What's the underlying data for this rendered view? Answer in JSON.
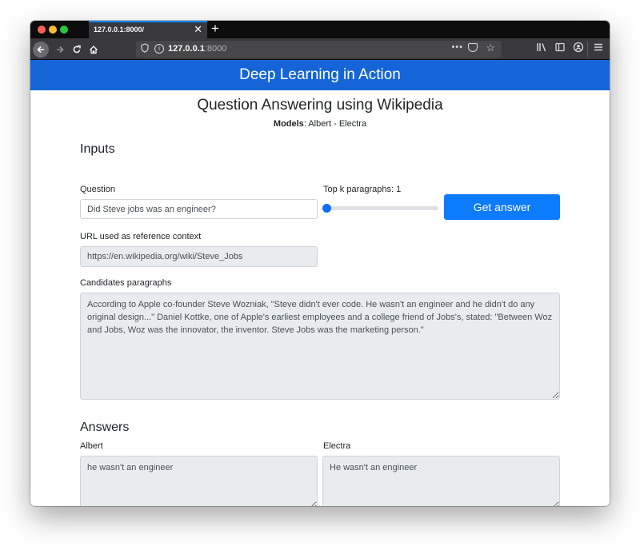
{
  "browser": {
    "tab_title": "127.0.0.1:8000/",
    "tab_close": "✕",
    "new_tab": "+",
    "url_host": "127.0.0.1",
    "url_port": ":8000",
    "icons": [
      "back-icon",
      "forward-icon",
      "reload-icon",
      "home-icon",
      "shield-icon",
      "info-icon",
      "more-icon",
      "pocket-icon",
      "star-icon",
      "library-icon",
      "sidebar-icon",
      "account-icon",
      "menu-icon"
    ]
  },
  "page": {
    "brand": "Deep Learning in Action",
    "subtitle": "Question Answering using Wikipedia",
    "models_label": "Models",
    "models_value": ": Albert - Electra",
    "inputs_heading": "Inputs",
    "question_label": "Question",
    "question_value": "Did Steve jobs was an engineer?",
    "topk_label": "Top k paragraphs: 1",
    "topk_value": 1,
    "answer_button": "Get answer",
    "url_label": "URL used as reference context",
    "url_value": "https://en.wikipedia.org/wiki/Steve_Jobs",
    "candidates_label": "Candidates paragraphs",
    "candidates_value": "According to Apple co-founder Steve Wozniak, \"Steve didn't ever code. He wasn't an engineer and he didn't do any original design...\" Daniel Kottke, one of Apple's earliest employees and a college friend of Jobs's, stated: \"Between Woz and Jobs, Woz was the innovator, the inventor. Steve Jobs was the marketing person.\"",
    "answers_heading": "Answers",
    "albert_label": "Albert",
    "albert_value": "he wasn't an engineer",
    "electra_label": "Electra",
    "electra_value": "He wasn't an engineer"
  },
  "colors": {
    "navbar": "#1565d8",
    "button": "#0d7bfd",
    "toolbar": "#38383d"
  }
}
